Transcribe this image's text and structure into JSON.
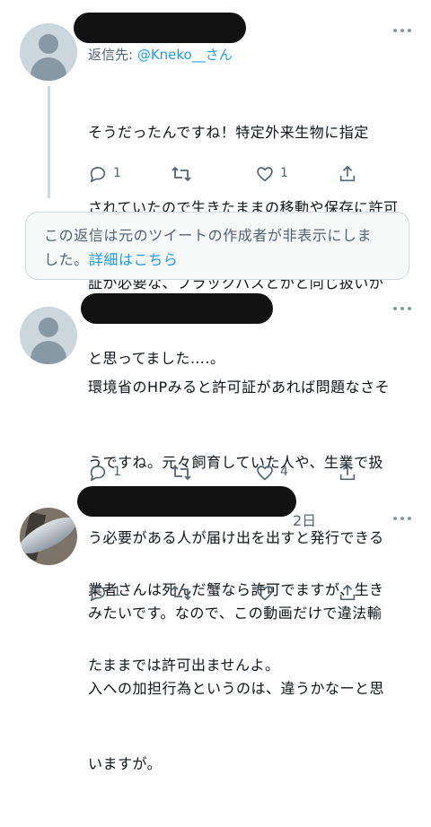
{
  "tweet1": {
    "reply_prefix": "返信先: ",
    "reply_handle": "@Kneko__さん",
    "body_lines": [
      "そうだったんですね！特定外来生物に指定",
      "されていたので生きたままの移動や保存に許可",
      "証が必要な、ブラックバスとかと同じ扱いか",
      "と思ってました….。"
    ],
    "reply_count": "1",
    "like_count": "1"
  },
  "hidden_notice": {
    "line1": "この返信は元のツイートの作成者が非表示にしま",
    "line2_prefix": "した。",
    "link_text": "詳細はこちら"
  },
  "tweet2": {
    "body_lines": [
      "環境省のHPみると許可証があれば問題なさそ",
      "うですね。元々飼育していた人や、生業で扱",
      "う必要がある人が届け出を出すと発行できる",
      "みたいです。なので、この動画だけで違法輸",
      "入への加担行為というのは、違うかなーと思",
      "いますが。"
    ],
    "reply_count": "1",
    "like_count": "4"
  },
  "tweet3": {
    "date": "2日",
    "body_lines": [
      "業者さんは死んだ蟹なら許可でますが、生き",
      "たままでは許可出ませんよ。"
    ],
    "reply_count": "1"
  },
  "icons": [
    "reply-icon",
    "retweet-icon",
    "like-icon",
    "share-icon",
    "more-icon",
    "default-avatar-icon"
  ],
  "colors": {
    "accent": "#1d9bf0",
    "secondary_text": "#536471",
    "border": "#cfd9de"
  }
}
